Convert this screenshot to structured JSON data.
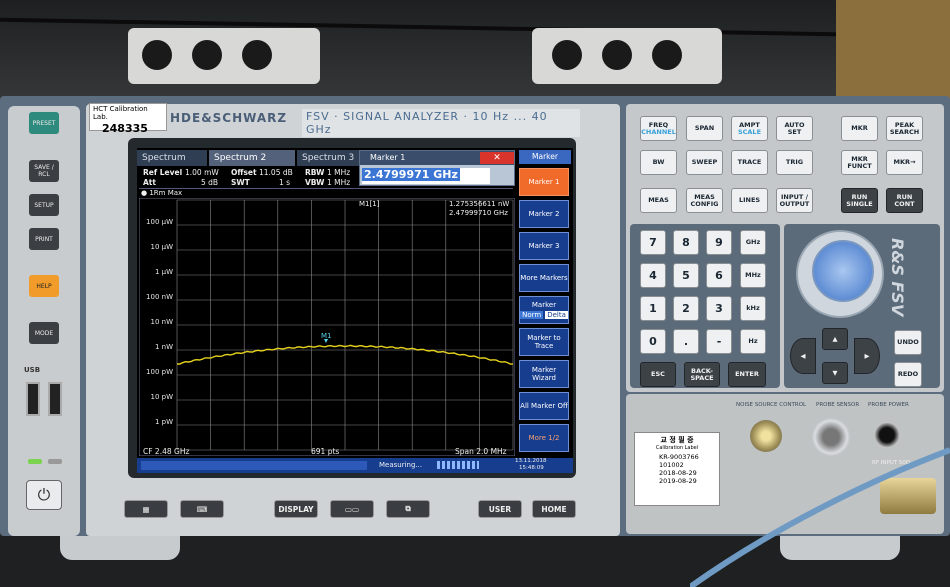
{
  "calibration_sticker": {
    "lab": "HCT Calibration Lab.",
    "number": "248335"
  },
  "brand": "HDE&SCHWARZ",
  "model": "FSV · SIGNAL ANALYZER · 10 Hz ... 40 GHz",
  "left_keys": [
    "PRESET",
    "SAVE / RCL",
    "SETUP",
    "PRINT",
    "HELP",
    "MODE"
  ],
  "usb_label": "USB",
  "tabs": [
    "Spectrum",
    "Spectrum 2",
    "Spectrum 3"
  ],
  "marker_dialog": {
    "title": "Marker 1",
    "value": "2.4799971 GHz",
    "close": "✕"
  },
  "header": {
    "ref_level_label": "Ref Level",
    "ref_level_value": "1.00 mW",
    "offset_label": "Offset",
    "offset_value": "11.05 dB",
    "rbw_label": "RBW",
    "rbw_value": "1 MHz",
    "att_label": "Att",
    "att_value": "5 dB",
    "swt_label": "SWT",
    "swt_value": "1 s",
    "vbw_label": "VBW",
    "vbw_value": "1 MHz"
  },
  "trace_label": "● 1Rm Max",
  "marker_readout": {
    "name": "M1[1]",
    "power": "1.275356611 nW",
    "freq": "2.47999710 GHz"
  },
  "marker_point_label": "M1",
  "y_axis": [
    "100 µW",
    "10 µW",
    "1 µW",
    "100 nW",
    "10 nW",
    "1 nW",
    "100 pW",
    "10 pW",
    "1 pW"
  ],
  "footer": {
    "cf": "CF 2.48 GHz",
    "pts": "691 pts",
    "span": "Span 2.0 MHz",
    "status": "Measuring...",
    "date": "13.11.2018",
    "time": "15:48:09"
  },
  "softkey_title": "Marker",
  "softkeys": [
    "Marker 1",
    "Marker 2",
    "Marker 3",
    "More Markers",
    "Marker",
    "Marker to Trace",
    "Marker Wizard",
    "All Marker Off",
    "More 1/2"
  ],
  "norm_delta": [
    "Norm",
    "Delta"
  ],
  "under_screen_keys": [
    "DISPLAY",
    "USER",
    "HOME"
  ],
  "func_keys": [
    {
      "label": "FREQ",
      "sub": "CHANNEL"
    },
    {
      "label": "SPAN",
      "sub": ""
    },
    {
      "label": "AMPT",
      "sub": "SCALE"
    },
    {
      "label": "AUTO SET",
      "sub": ""
    },
    {
      "label": "BW",
      "sub": ""
    },
    {
      "label": "SWEEP",
      "sub": ""
    },
    {
      "label": "TRACE",
      "sub": ""
    },
    {
      "label": "TRIG",
      "sub": ""
    },
    {
      "label": "MEAS",
      "sub": ""
    },
    {
      "label": "MEAS CONFIG",
      "sub": ""
    },
    {
      "label": "LINES",
      "sub": ""
    },
    {
      "label": "INPUT / OUTPUT",
      "sub": ""
    }
  ],
  "marker_keys": [
    "MKR",
    "PEAK SEARCH",
    "MKR FUNCT",
    "MKR→",
    "RUN SINGLE",
    "RUN CONT"
  ],
  "numpad": [
    "7",
    "8",
    "9",
    "4",
    "5",
    "6",
    "1",
    "2",
    "3",
    "0",
    ".",
    "-"
  ],
  "unit_keys": [
    "GHz",
    "MHz",
    "kHz",
    "Hz"
  ],
  "keypad_bottom": [
    "ESC",
    "BACK-SPACE",
    "ENTER"
  ],
  "undo_redo": [
    "UNDO",
    "REDO"
  ],
  "rs_logo": "R&S FSV",
  "connector_labels": [
    "NOISE SOURCE CONTROL",
    "PROBE SENSOR",
    "PROBE POWER"
  ],
  "cal_label": {
    "title": "교 정 필 증",
    "subtitle": "Calibration Label",
    "id": "KR-9003766",
    "serial": "101002",
    "date1": "2018-08-29",
    "date2": "2019-08-29"
  },
  "rf_input": "RF INPUT 50Ω"
}
